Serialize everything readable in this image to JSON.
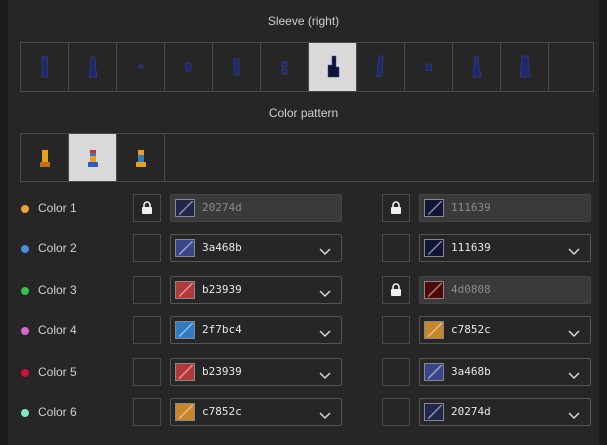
{
  "sleeve": {
    "title": "Sleeve (right)",
    "selected_index": 6,
    "items": [
      "sleeve-long-icon",
      "sleeve-cuffed-icon",
      "sleeve-tiny-icon",
      "sleeve-short-icon",
      "sleeve-medium-icon",
      "sleeve-puff-icon",
      "sleeve-glove-icon",
      "sleeve-slim-icon",
      "sleeve-cap-icon",
      "sleeve-bell-icon",
      "sleeve-wide-icon",
      "sleeve-none"
    ]
  },
  "pattern": {
    "title": "Color pattern",
    "selected_index": 1,
    "items": [
      "pattern-plain-icon",
      "pattern-striped-icon",
      "pattern-two-tone-icon"
    ]
  },
  "colors": [
    {
      "label": "Color 1",
      "dot": "#e8a23c",
      "left_locked": true,
      "left_hex": "20274d",
      "left_color": "#20274d",
      "right_locked": true,
      "right_hex": "111639",
      "right_color": "#111639"
    },
    {
      "label": "Color 2",
      "dot": "#4a8fe0",
      "left_locked": false,
      "left_hex": "3a468b",
      "left_color": "#3a468b",
      "right_locked": false,
      "right_hex": "111639",
      "right_color": "#111639"
    },
    {
      "label": "Color 3",
      "dot": "#3cc24a",
      "left_locked": false,
      "left_hex": "b23939",
      "left_color": "#b23939",
      "right_locked": true,
      "right_hex": "4d0808",
      "right_color": "#4d0808"
    },
    {
      "label": "Color 4",
      "dot": "#d46ad0",
      "left_locked": false,
      "left_hex": "2f7bc4",
      "left_color": "#2f7bc4",
      "right_locked": false,
      "right_hex": "c7852c",
      "right_color": "#c7852c"
    },
    {
      "label": "Color 5",
      "dot": "#d0103a",
      "left_locked": false,
      "left_hex": "b23939",
      "left_color": "#b23939",
      "right_locked": false,
      "right_hex": "3a468b",
      "right_color": "#3a468b"
    },
    {
      "label": "Color 6",
      "dot": "#7ee8c8",
      "left_locked": false,
      "left_hex": "c7852c",
      "left_color": "#c7852c",
      "right_locked": false,
      "right_hex": "20274d",
      "right_color": "#20274d"
    }
  ]
}
